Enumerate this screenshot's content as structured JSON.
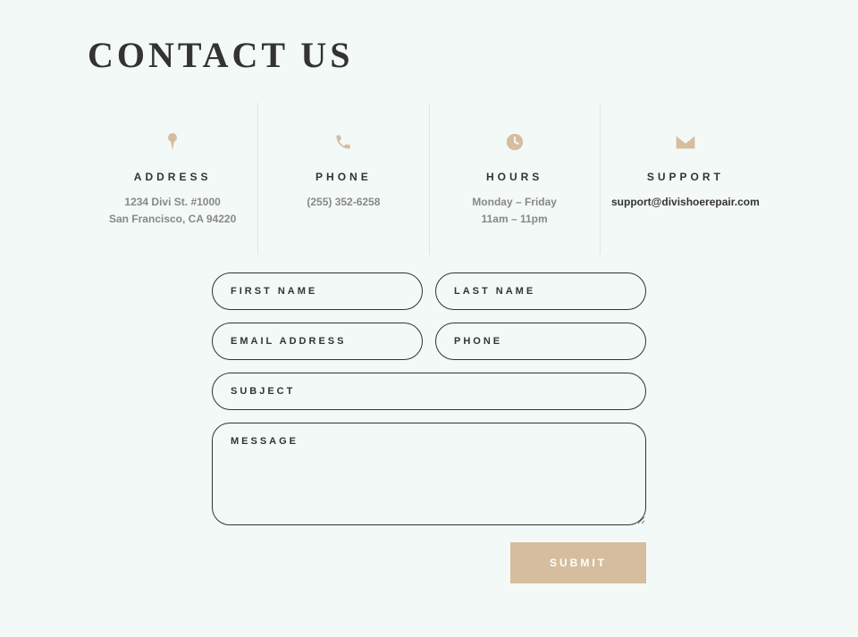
{
  "title": "CONTACT US",
  "info": {
    "address": {
      "title": "ADDRESS",
      "line1": "1234 Divi St. #1000",
      "line2": "San Francisco, CA 94220"
    },
    "phone": {
      "title": "PHONE",
      "line1": "(255) 352-6258"
    },
    "hours": {
      "title": "HOURS",
      "line1": "Monday – Friday",
      "line2": "11am – 11pm"
    },
    "support": {
      "title": "SUPPORT",
      "line1": "support@divishoerepair.com"
    }
  },
  "form": {
    "first_name": "FIRST NAME",
    "last_name": "LAST NAME",
    "email": "EMAIL ADDRESS",
    "phone": "PHONE",
    "subject": "SUBJECT",
    "message": "MESSAGE",
    "submit": "SUBMIT"
  },
  "colors": {
    "accent": "#d6bd9e"
  }
}
